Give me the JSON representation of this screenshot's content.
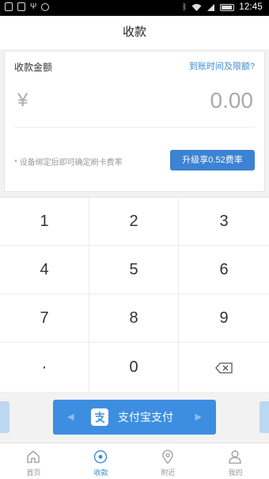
{
  "status_bar": {
    "time": "12:45",
    "left_icons": [
      "trash-icon",
      "image-icon",
      "usb-icon",
      "sync-icon"
    ],
    "right_icons": [
      "bluetooth-icon",
      "wifi-icon",
      "signal-icon",
      "battery-icon"
    ]
  },
  "nav": {
    "title": "收款"
  },
  "amount_card": {
    "label": "收款金额",
    "limit_link": "到账时间及限额?",
    "currency_symbol": "¥",
    "amount": "0.00",
    "tip": "* 设备绑定后即可确定刷卡费率",
    "upgrade_button": "升级享0.52费率"
  },
  "keypad": {
    "keys": [
      "1",
      "2",
      "3",
      "4",
      "5",
      "6",
      "7",
      "8",
      "9",
      "·",
      "0"
    ],
    "backspace_icon": "backspace-icon"
  },
  "pay": {
    "label": "支付宝支付",
    "icon": "alipay-icon"
  },
  "tabs": [
    {
      "label": "首页",
      "icon": "home-icon",
      "active": false
    },
    {
      "label": "收款",
      "icon": "collect-icon",
      "active": true
    },
    {
      "label": "附近",
      "icon": "location-icon",
      "active": false
    },
    {
      "label": "我的",
      "icon": "user-icon",
      "active": false
    }
  ],
  "colors": {
    "accent": "#3d8ee0",
    "upgrade_button": "#3d82d3",
    "link": "#3b8dd8",
    "placeholder": "#aaaaaa"
  }
}
